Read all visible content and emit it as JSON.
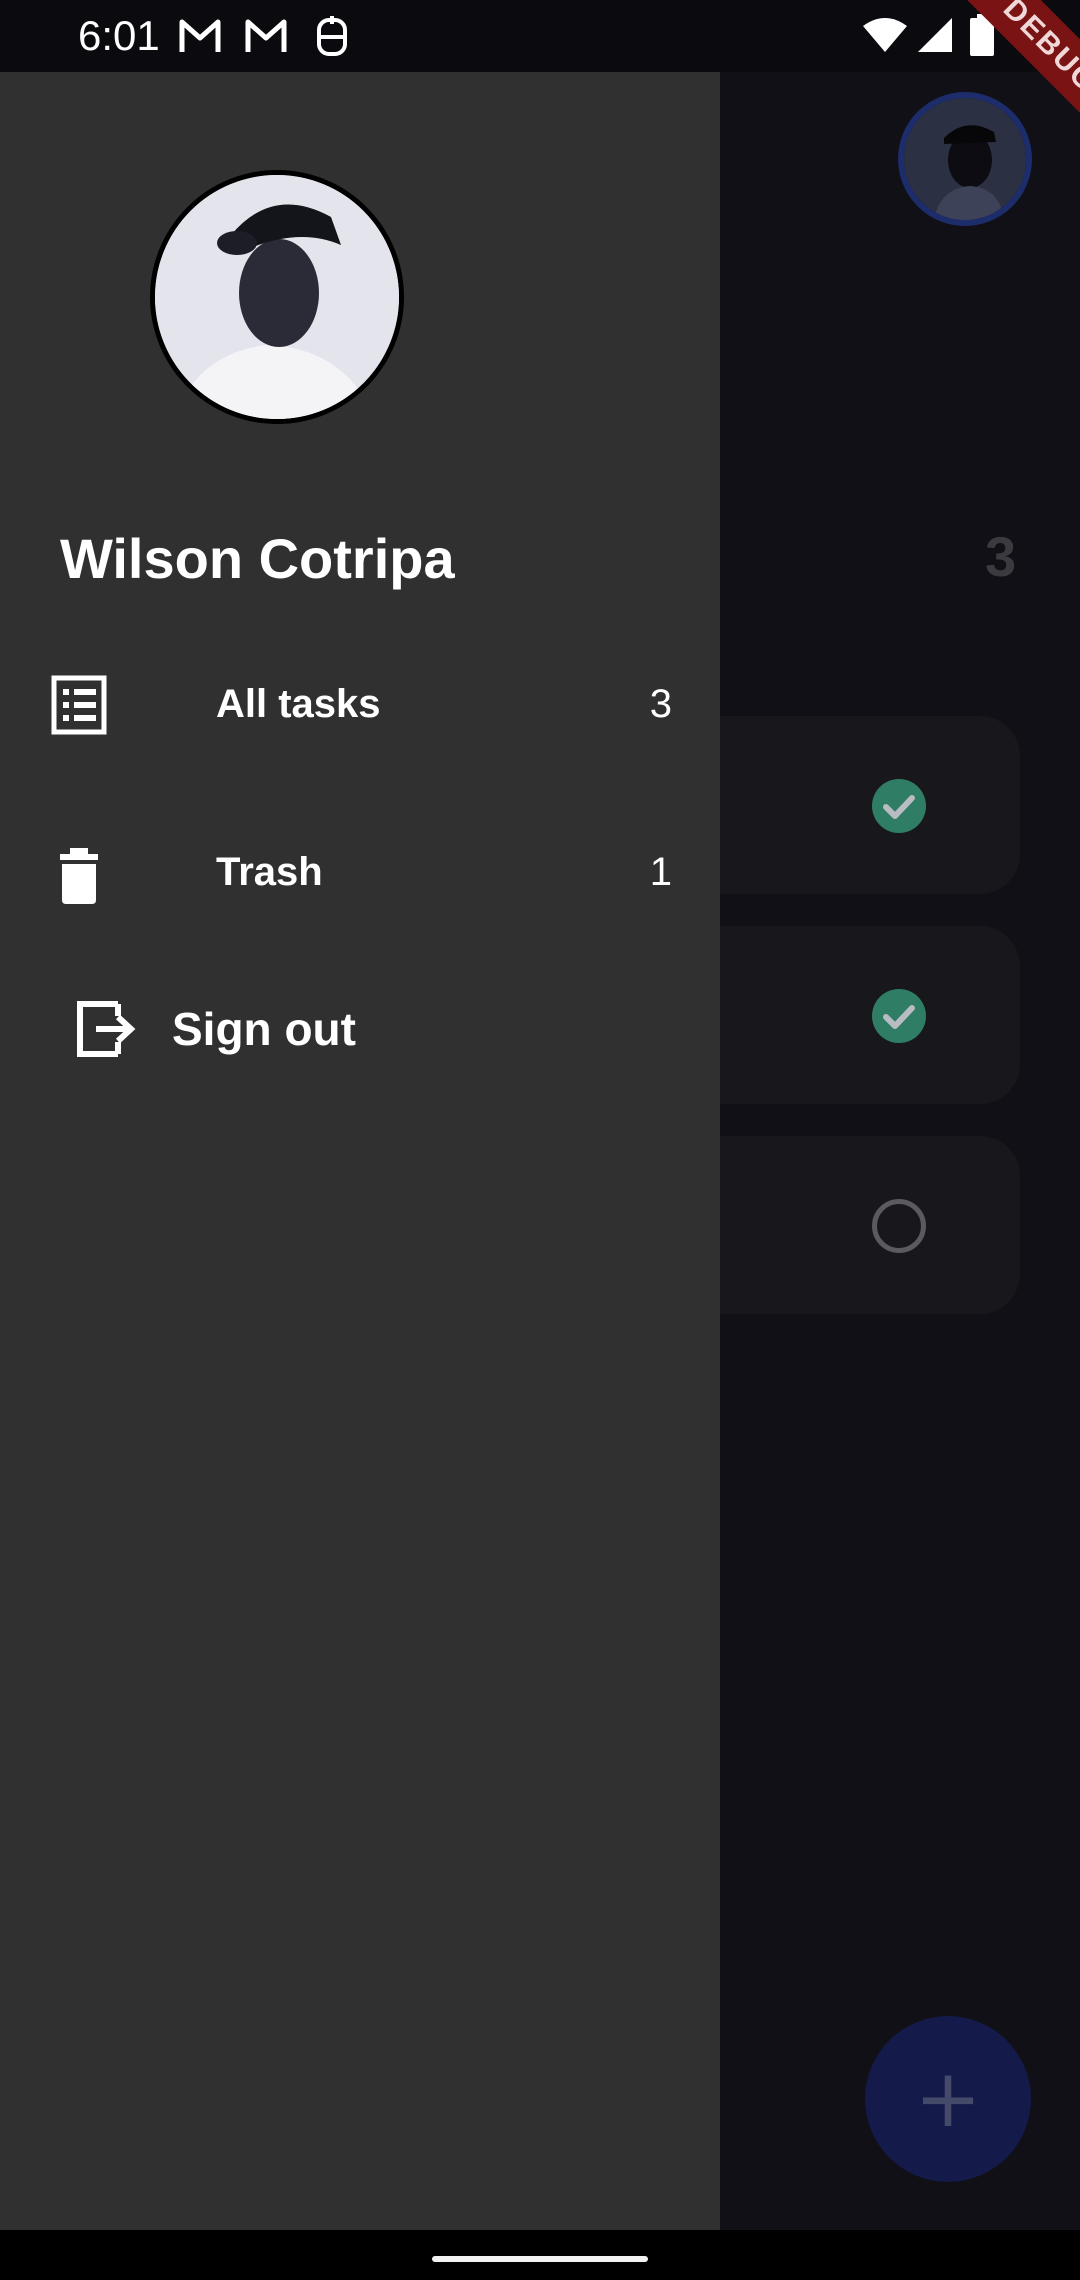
{
  "status_bar": {
    "time": "6:01",
    "notification_icons": [
      "gmail-icon",
      "gmail-icon",
      "vpn-icon"
    ],
    "system_icons": [
      "wifi-icon",
      "signal-icon",
      "battery-icon"
    ]
  },
  "debug_banner": {
    "label": "DEBUG"
  },
  "background": {
    "task_count": "3",
    "tasks": [
      {
        "completed": true
      },
      {
        "completed": true
      },
      {
        "completed": false
      }
    ],
    "fab_icon": "plus-icon",
    "fab_label": "+"
  },
  "drawer": {
    "user_name": "Wilson Cotripa",
    "items": [
      {
        "label": "All tasks",
        "count": "3",
        "icon": "list-icon"
      },
      {
        "label": "Trash",
        "count": "1",
        "icon": "trash-icon"
      }
    ],
    "sign_out": {
      "label": "Sign out",
      "icon": "logout-icon"
    }
  },
  "colors": {
    "drawer_bg": "#303030",
    "scrim_bg": "#101016",
    "check_done": "#2e7d64",
    "fab": "#141a4a",
    "debug": "#7a1414"
  }
}
